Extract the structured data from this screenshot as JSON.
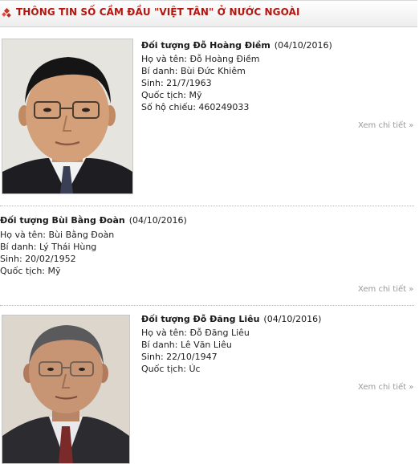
{
  "header": {
    "title": "THÔNG TIN SỐ CẦM ĐẦU \"VIỆT TÂN\" Ở NƯỚC NGOÀI",
    "icon": "red-diamond-bullet-icon",
    "accent_color": "#b3150f"
  },
  "entries": [
    {
      "title": "Đối tượng Đỗ Hoàng Điềm",
      "date": "(04/10/2016)",
      "lines": [
        "Họ và tên: Đỗ Hoàng Điềm",
        "Bí danh: Bùi Đức Khiêm",
        "Sinh: 21/7/1963",
        "Quốc tịch: Mỹ",
        "Số hộ chiếu: 460249033"
      ],
      "more": "Xem chi tiết »"
    },
    {
      "title": "Đối tượng Bùi Bằng Đoàn",
      "date": "(04/10/2016)",
      "lines": [
        "Họ và tên: Bùi Bằng Đoàn",
        "Bí danh: Lý Thái Hùng",
        "Sinh: 20/02/1952",
        "Quốc tịch: Mỹ"
      ],
      "more": "Xem chi tiết »"
    },
    {
      "title": "Đối tượng Đỗ Đăng Liêu",
      "date": "(04/10/2016)",
      "lines": [
        "Họ và tên: Đỗ Đăng Liêu",
        "Bí danh: Lê Văn Liêu",
        "Sinh: 22/10/1947",
        "Quốc tịch: Úc"
      ],
      "more": "Xem chi tiết »"
    }
  ]
}
